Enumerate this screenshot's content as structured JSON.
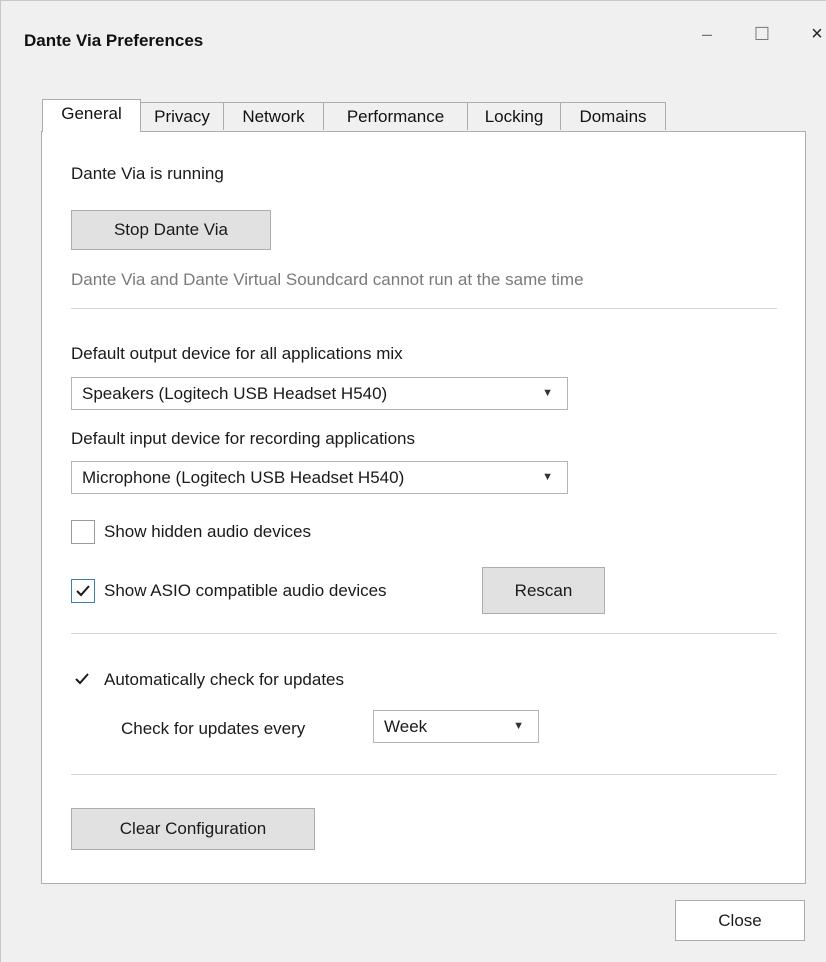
{
  "window": {
    "title": "Dante Via Preferences",
    "minimize_glyph": "–",
    "maximize_glyph": "☐",
    "close_glyph": "×"
  },
  "tabs": [
    {
      "label": "General",
      "active": true
    },
    {
      "label": "Privacy",
      "active": false
    },
    {
      "label": "Network",
      "active": false
    },
    {
      "label": "Performance",
      "active": false
    },
    {
      "label": "Locking",
      "active": false
    },
    {
      "label": "Domains",
      "active": false
    }
  ],
  "general": {
    "status_text": "Dante Via is running",
    "stop_button": "Stop Dante Via",
    "conflict_note": "Dante Via and Dante Virtual Soundcard cannot run at the same time",
    "output_label": "Default output device for all applications mix",
    "output_value": "Speakers (Logitech USB Headset H540)",
    "input_label": "Default input device for recording applications",
    "input_value": "Microphone (Logitech USB Headset H540)",
    "show_hidden_label": "Show hidden audio devices",
    "show_hidden_checked": false,
    "show_asio_label": "Show ASIO compatible audio devices",
    "show_asio_checked": true,
    "rescan_button": "Rescan",
    "auto_update_label": "Automatically check for updates",
    "auto_update_checked": true,
    "update_every_label": "Check for updates every",
    "update_every_value": "Week",
    "clear_button": "Clear Configuration"
  },
  "footer": {
    "close_button": "Close"
  },
  "colors": {
    "window_bg": "#f0f0f0",
    "panel_bg": "#ffffff",
    "checkmark": "#1a1a1a",
    "focus_border": "#3c7fb1",
    "muted_text": "#7a7a7a"
  }
}
